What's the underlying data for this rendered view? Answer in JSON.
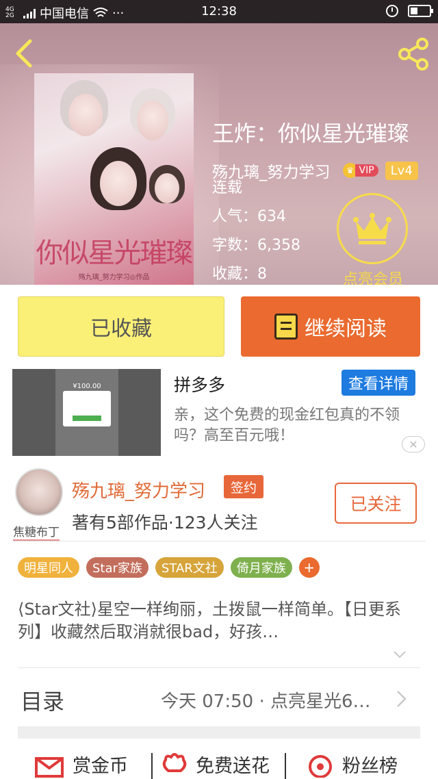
{
  "status_bar": {
    "network": "4G 2G",
    "carrier": "中国电信",
    "more": "···",
    "time": "12:38"
  },
  "header": {
    "back_icon": "back-arrow-icon",
    "share_icon": "share-icon"
  },
  "book": {
    "cover_title": "你似星光璀璨",
    "cover_author": "殇九璃_努力学习◎作品",
    "title": "王炸：你似星光璀璨",
    "author": "殇九璃_努力学习",
    "vip": "VIP",
    "level": "Lv4",
    "status": "连载",
    "popularity": "人气：634",
    "word_count": "字数：6,358",
    "favorites": "收藏：8",
    "member_label": "点亮会员"
  },
  "actions": {
    "collected_label": "已收藏",
    "continue_label": "继续阅读"
  },
  "ad": {
    "image_amount": "¥100.00",
    "title": "拼多多",
    "detail_button": "查看详情",
    "description": "亲，这个免费的现金红包真的不领吗？高至百元哦！",
    "close": "✕"
  },
  "author": {
    "avatar_tag": "焦糖布丁",
    "name": "殇九璃_努力学习",
    "sign_badge": "签约",
    "stats": "著有5部作品·123人关注",
    "follow_button": "已关注"
  },
  "tags": [
    {
      "label": "明星同人",
      "color": "#f0b23c"
    },
    {
      "label": "Star家族",
      "color": "#c36e5c"
    },
    {
      "label": "STAR文社",
      "color": "#d6a43a"
    },
    {
      "label": "倚月家族",
      "color": "#7fb04e"
    }
  ],
  "tag_add": "+",
  "description": "⟨Star文社⟩星空一样绚丽，土拨鼠一样简单。【日更系列】收藏然后取消就很bad，好孩…",
  "toc": {
    "label": "目录",
    "latest": "今天 07:50 · 点亮星光6…"
  },
  "bottom_nav": {
    "reward": "赏金币",
    "flowers": "免费送花",
    "fans": "粉丝榜"
  },
  "colors": {
    "accent_orange": "#ea6a2f",
    "collected_yellow": "#fbf077",
    "ad_blue": "#1e7be0",
    "gold": "#f7dc4a"
  }
}
